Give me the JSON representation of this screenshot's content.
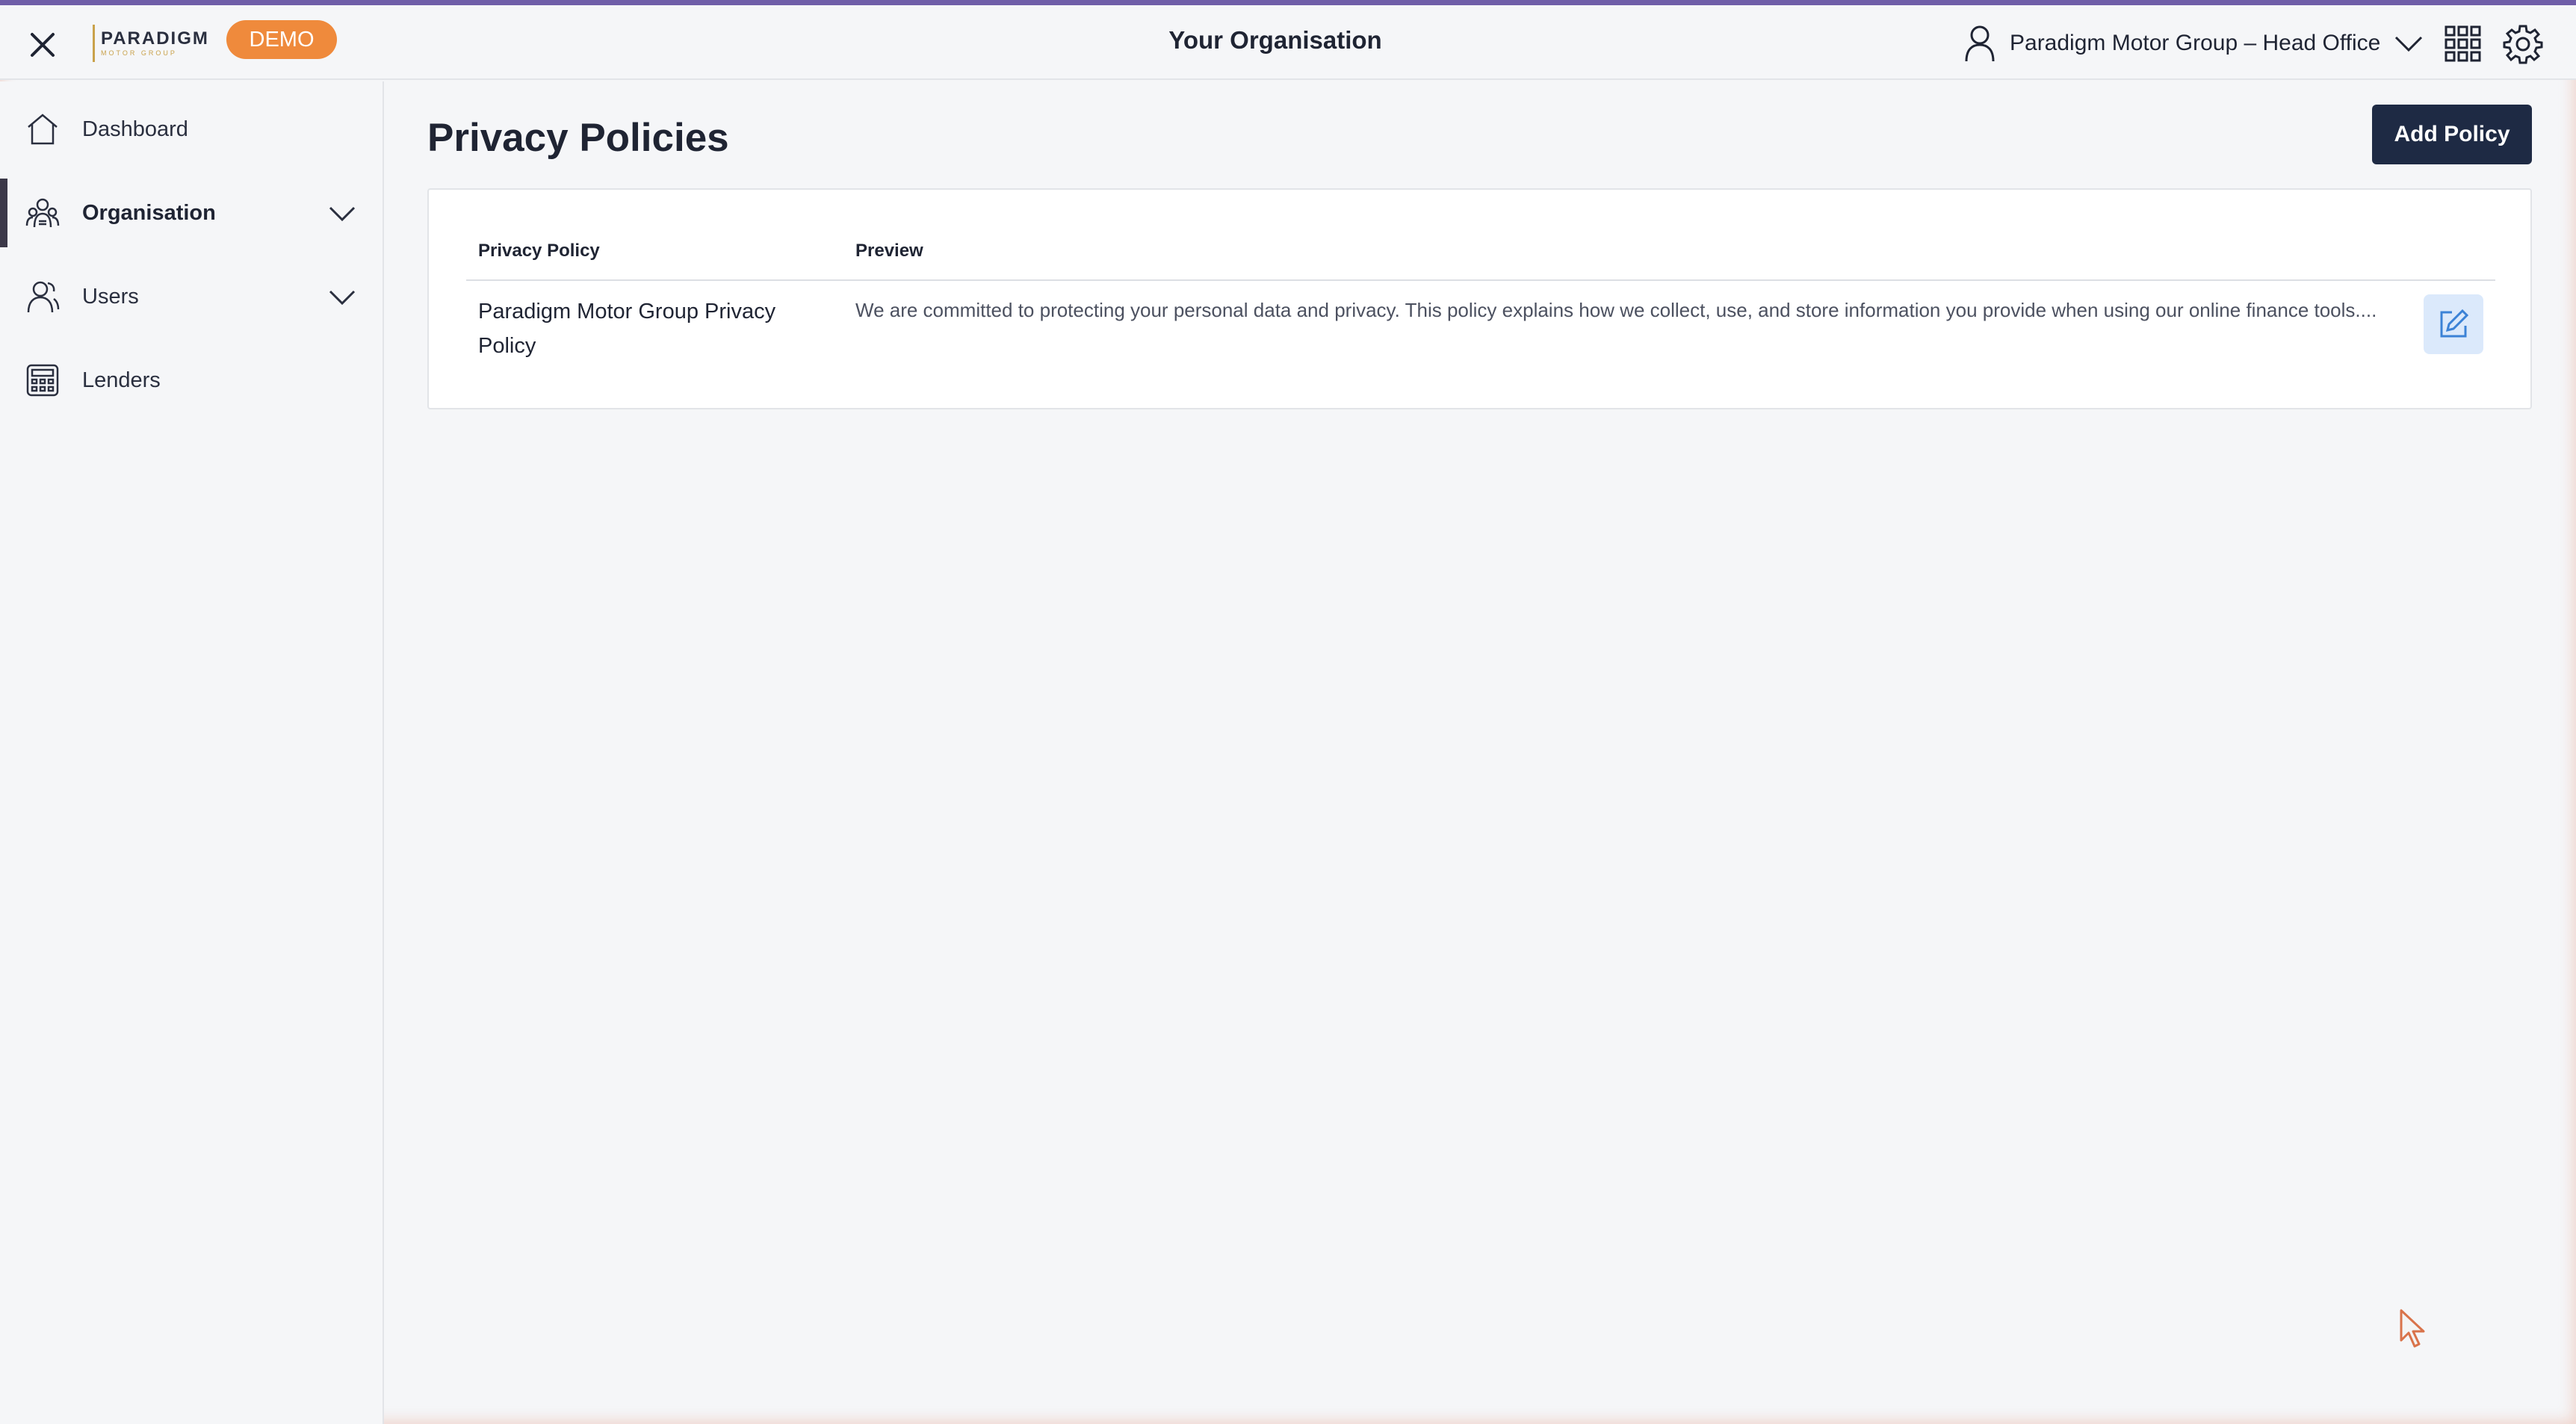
{
  "app": {
    "logo_text": "PARADIGM",
    "logo_subtext": "MOTOR GROUP",
    "environment_badge": "DEMO",
    "page_heading": "Your Organisation"
  },
  "header": {
    "org_selector": "Paradigm Motor Group – Head Office",
    "icons": [
      "close-icon",
      "user-icon",
      "chevron-down-icon",
      "apps-grid-icon",
      "gear-icon"
    ]
  },
  "sidebar": {
    "items": [
      {
        "label": "Dashboard",
        "icon": "home-icon",
        "expandable": false,
        "active": false
      },
      {
        "label": "Organisation",
        "icon": "organisation-icon",
        "expandable": true,
        "active": true
      },
      {
        "label": "Users",
        "icon": "users-icon",
        "expandable": true,
        "active": false
      },
      {
        "label": "Lenders",
        "icon": "calculator-icon",
        "expandable": false,
        "active": false
      }
    ]
  },
  "main": {
    "title": "Privacy Policies",
    "add_button": "Add Policy",
    "table": {
      "columns": [
        "Privacy Policy",
        "Preview"
      ],
      "rows": [
        {
          "name": "Paradigm Motor Group Privacy Policy",
          "preview": "We are committed to protecting your personal data and privacy. This policy explains how we collect, use, and store information you provide when using our online finance tools...."
        }
      ]
    }
  },
  "colors": {
    "accent_top": "#6f5ea8",
    "demo_badge": "#ef8a3c",
    "primary_button": "#1e2a44",
    "edit_button_bg": "#dbe9fb",
    "edit_icon": "#3b82d6",
    "background": "#f5f6f8"
  }
}
